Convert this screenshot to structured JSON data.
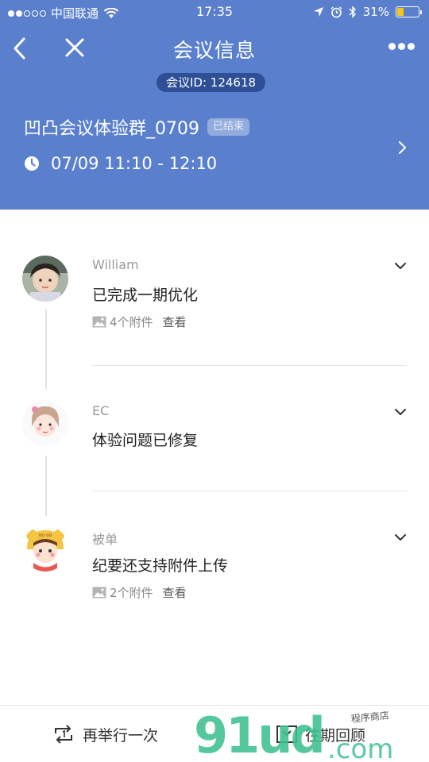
{
  "status_bar": {
    "carrier": "中国联通",
    "time": "17:35",
    "battery_percent": "31%",
    "battery_level": 0.31,
    "battery_color": "#f5c518"
  },
  "nav": {
    "title": "会议信息",
    "back_icon": "chevron-left-icon",
    "close_icon": "close-icon",
    "more_icon": "more-dots-icon"
  },
  "meeting": {
    "id_label": "会议ID: 124618",
    "name": "凹凸会议体验群_0709",
    "status": "已结束",
    "time_range": "07/09 11:10 - 12:10"
  },
  "entries": [
    {
      "author": "William",
      "text": "已完成一期优化",
      "attachments": "4个附件",
      "view": "查看"
    },
    {
      "author": "EC",
      "text": "体验问题已修复"
    },
    {
      "author": "被单",
      "text": "纪要还支持附件上传",
      "attachments": "2个附件",
      "view": "查看"
    }
  ],
  "bottom": {
    "redo_label": "再举行一次",
    "history_label": "往期回顾"
  },
  "watermark": {
    "brand": "91ud",
    "domain": ".com",
    "tagline": "程序商店"
  },
  "colors": {
    "header_bg": "#5a80cd",
    "id_pill_bg": "#2e4f95",
    "watermark": "#3ec090"
  }
}
